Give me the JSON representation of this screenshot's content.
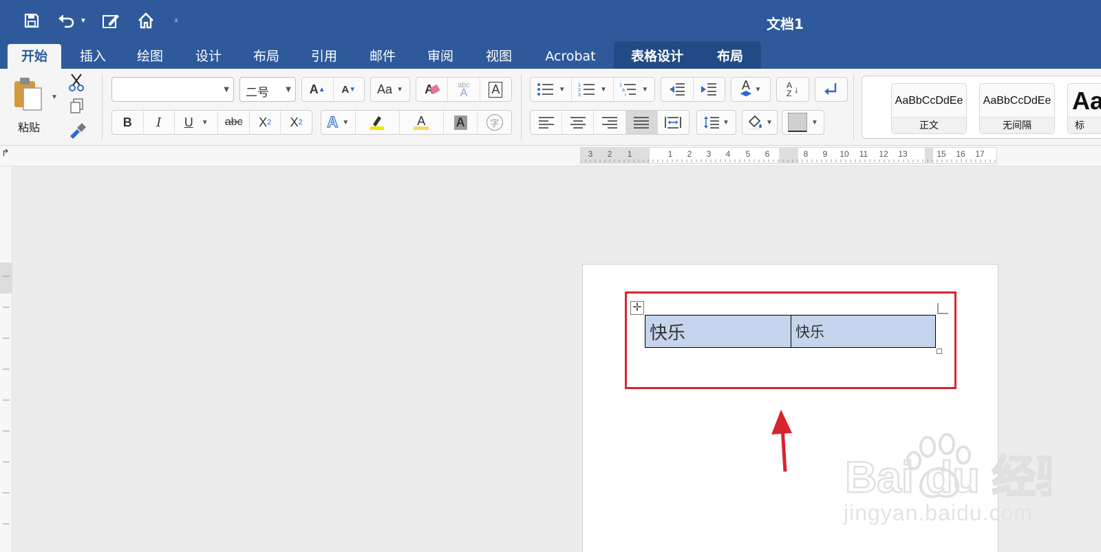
{
  "window": {
    "title": "文档1"
  },
  "quick_access": {
    "icons": [
      "save-icon",
      "undo-icon",
      "edit-doc-icon",
      "home-icon",
      "customize-icon"
    ]
  },
  "tabs": [
    {
      "label": "开始",
      "active": true
    },
    {
      "label": "插入"
    },
    {
      "label": "绘图"
    },
    {
      "label": "设计"
    },
    {
      "label": "布局"
    },
    {
      "label": "引用"
    },
    {
      "label": "邮件"
    },
    {
      "label": "审阅"
    },
    {
      "label": "视图"
    },
    {
      "label": "Acrobat"
    },
    {
      "label": "表格设计",
      "context": true
    },
    {
      "label": "布局",
      "context": true
    }
  ],
  "ribbon": {
    "paste_label": "粘贴",
    "font_name": "",
    "font_size": "二号",
    "buttons": {
      "bold": "B",
      "italic": "I",
      "underline": "U",
      "strikethrough": "abc",
      "subscript": "X",
      "subscript_mark": "2",
      "superscript": "X",
      "superscript_mark": "2",
      "grow_font": "A",
      "shrink_font": "A",
      "change_case": "Aa",
      "clear_format": "A",
      "phonetic": "abc",
      "phonetic_letter": "A",
      "char_border": "A",
      "text_effects": "A",
      "font_color": "A",
      "char_shading": "A",
      "enclose_char": "字",
      "sort_a": "A",
      "sort_z": "Z",
      "text_direction": "A"
    },
    "styles": [
      {
        "sample": "AaBbCcDdEe",
        "name": "正文"
      },
      {
        "sample": "AaBbCcDdEe",
        "name": "无间隔"
      },
      {
        "sample": "Aa",
        "name": "标"
      }
    ]
  },
  "ruler": {
    "labels": [
      "3",
      "2",
      "1",
      "1",
      "2",
      "3",
      "4",
      "5",
      "6",
      "8",
      "9",
      "10",
      "11",
      "12",
      "13",
      "15",
      "16",
      "17"
    ]
  },
  "document": {
    "table": [
      [
        "快乐",
        "快乐"
      ]
    ]
  },
  "watermark": {
    "brand": "Bai du 经验",
    "url": "jingyan.baidu.com"
  },
  "colors": {
    "accent": "#2e5a9c",
    "highlight_border": "#d9232e",
    "cell_selection": "#c6d4ed"
  }
}
